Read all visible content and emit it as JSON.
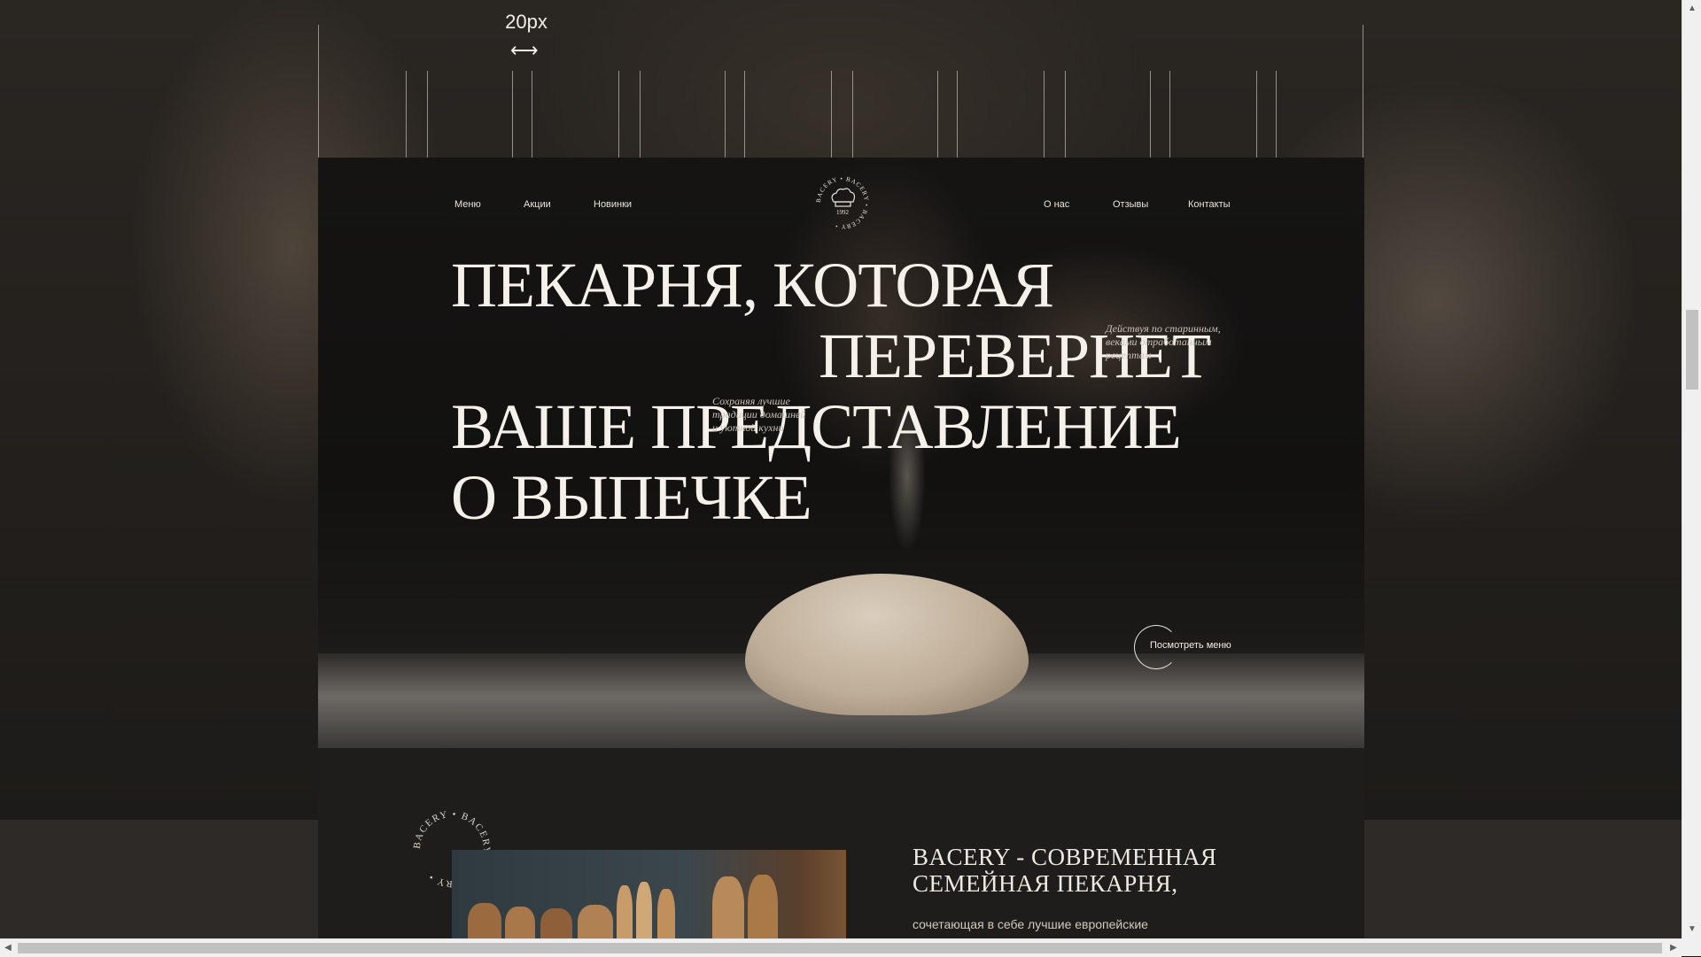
{
  "guide": {
    "gap_label": "20px",
    "gap_arrow": "⟷"
  },
  "nav": {
    "left": [
      "Меню",
      "Акции",
      "Новинки"
    ],
    "right": [
      "О нас",
      "Отзывы",
      "Контакты"
    ]
  },
  "logo": {
    "ring_text": "BACERY • BACERY • BACERY •",
    "year": "1992",
    "icon": "chef-hat-icon"
  },
  "hero": {
    "line1": "ПЕКАРНЯ, КОТОРАЯ",
    "line2": "ПЕРЕВЕРНЕТ",
    "line3": "ВАШЕ ПРЕДСТАВЛЕНИЕ",
    "line4": "О ВЫПЕЧКЕ",
    "tagline_right": [
      "Действуя по старинным,",
      "веками отработанным",
      "рецептам"
    ],
    "tagline_left": [
      "Сохраняя лучшие",
      "традиции домашней",
      "и уютной кухни"
    ],
    "cta_label": "Посмотреть меню"
  },
  "about": {
    "badge_text": "BACERY • BACERY • BACERY •",
    "title_line1": "BACERY - СОВРЕМЕННАЯ",
    "title_line2": "СЕМЕЙНАЯ ПЕКАРНЯ,",
    "text": "сочетающая в себе лучшие европейские"
  },
  "scrollbars": {
    "up": "▲",
    "down": "▼",
    "left": "◀",
    "right": "▶"
  }
}
